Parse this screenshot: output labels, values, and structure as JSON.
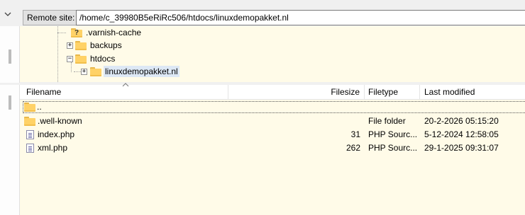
{
  "remote_site": {
    "label": "Remote site:",
    "path": "/home/c_39980B5eRiRc506/htdocs/linuxdemopakket.nl"
  },
  "tree": {
    "items": [
      {
        "label": ".varnish-cache",
        "icon": "unknown-folder-icon",
        "expander": "none"
      },
      {
        "label": "backups",
        "icon": "folder-icon",
        "expander": "+"
      },
      {
        "label": "htdocs",
        "icon": "folder-icon",
        "expander": "-"
      },
      {
        "label": "linuxdemopakket.nl",
        "icon": "folder-icon",
        "expander": "+",
        "selected": true
      }
    ]
  },
  "file_list": {
    "columns": [
      "Filename",
      "Filesize",
      "Filetype",
      "Last modified"
    ],
    "sort_column": "Filename",
    "rows": [
      {
        "name": "..",
        "size": "",
        "type": "",
        "modified": "",
        "icon": "folder-icon"
      },
      {
        "name": ".well-known",
        "size": "",
        "type": "File folder",
        "modified": "20-2-2026 05:15:20",
        "icon": "folder-icon"
      },
      {
        "name": "index.php",
        "size": "31",
        "type": "PHP Sourc...",
        "modified": "5-12-2024 12:58:05",
        "icon": "php-file-icon"
      },
      {
        "name": "xml.php",
        "size": "262",
        "type": "PHP Sourc...",
        "modified": "29-1-2025 09:31:07",
        "icon": "php-file-icon"
      }
    ]
  },
  "colors": {
    "pane_background": "#fffbe8",
    "folder": "#ffd267",
    "selection": "#dde8f5"
  }
}
